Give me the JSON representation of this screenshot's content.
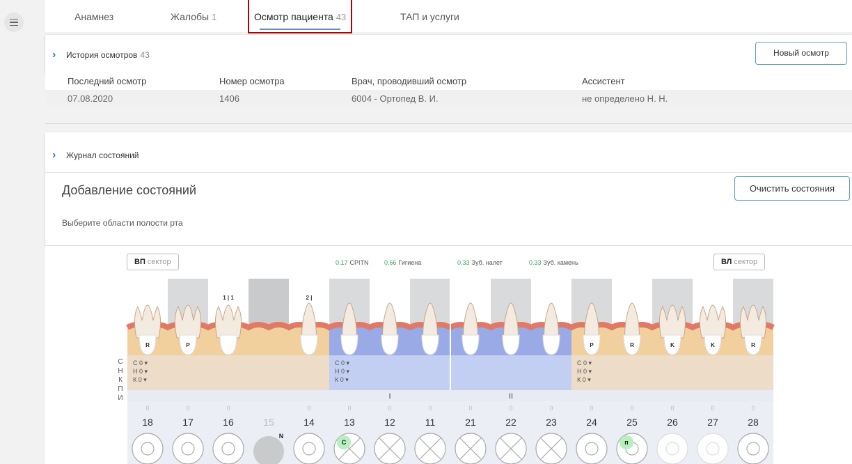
{
  "tabs": [
    {
      "label": "Анамнез",
      "count": ""
    },
    {
      "label": "Жалобы",
      "count": "1"
    },
    {
      "label": "Осмотр пациента",
      "count": "43"
    },
    {
      "label": "ТАП и услуги",
      "count": ""
    }
  ],
  "history": {
    "title": "История осмотров",
    "count": "43",
    "new_button": "Новый осмотр",
    "columns": [
      "Последний осмотр",
      "Номер осмотра",
      "Врач, проводивший осмотр",
      "Ассистент"
    ],
    "rows": [
      [
        "07.08.2020",
        "1406",
        "6004 - Ортопед В. И.",
        "не определено Н. Н."
      ]
    ]
  },
  "journal": {
    "title": "Журнал состояний",
    "add_title": "Добавление состояний",
    "clear_button": "Очистить состояния",
    "hint": "Выберите области полости рта"
  },
  "chart": {
    "left_sector": {
      "bold": "ВП",
      "text": "сектор"
    },
    "right_sector": {
      "bold": "ВЛ",
      "text": "сектор"
    },
    "metrics": [
      {
        "value": "0.17",
        "label": "CPITN"
      },
      {
        "value": "0.66",
        "label": "Гигиена"
      },
      {
        "value": "0.33",
        "label": "Зуб. налет"
      },
      {
        "value": "0.33",
        "label": "Зуб. камень"
      }
    ],
    "row_letters": [
      "С",
      "Н",
      "К",
      "П",
      "И"
    ],
    "group_rows": [
      "С 0",
      "Н 0",
      "К 0"
    ],
    "quadrants": [
      "I",
      "II"
    ],
    "upper_marks": {
      "16": "1 | 1",
      "14": "2 |"
    },
    "teeth": [
      {
        "num": "18",
        "root_label": "R",
        "zero": "0",
        "crown": "normal",
        "mark": ""
      },
      {
        "num": "17",
        "root_label": "P",
        "zero": "0",
        "crown": "normal",
        "mark": ""
      },
      {
        "num": "16",
        "root_label": "",
        "zero": "0",
        "crown": "normal",
        "mark": ""
      },
      {
        "num": "15",
        "root_label": "",
        "zero": "",
        "crown": "missing",
        "mark": "N"
      },
      {
        "num": "14",
        "root_label": "",
        "zero": "0",
        "crown": "normal",
        "mark": ""
      },
      {
        "num": "13",
        "root_label": "",
        "zero": "0",
        "crown": "cross",
        "mark": "C"
      },
      {
        "num": "12",
        "root_label": "",
        "zero": "0",
        "crown": "cross",
        "mark": ""
      },
      {
        "num": "11",
        "root_label": "",
        "zero": "0",
        "crown": "cross",
        "mark": ""
      },
      {
        "num": "21",
        "root_label": "",
        "zero": "0",
        "crown": "cross",
        "mark": ""
      },
      {
        "num": "22",
        "root_label": "",
        "zero": "0",
        "crown": "cross",
        "mark": ""
      },
      {
        "num": "23",
        "root_label": "",
        "zero": "0",
        "crown": "cross",
        "mark": ""
      },
      {
        "num": "24",
        "root_label": "P",
        "zero": "0",
        "crown": "normal",
        "mark": ""
      },
      {
        "num": "25",
        "root_label": "R",
        "zero": "0",
        "crown": "normal",
        "mark": "п"
      },
      {
        "num": "26",
        "root_label": "K",
        "zero": "0",
        "crown": "faded",
        "mark": ""
      },
      {
        "num": "27",
        "root_label": "K",
        "zero": "0",
        "crown": "faded",
        "mark": ""
      },
      {
        "num": "28",
        "root_label": "R",
        "zero": "0",
        "crown": "normal",
        "mark": ""
      }
    ],
    "colors": {
      "gum": "#e07a66",
      "bone_orange": "#f1d09e",
      "bone_blue": "#9aaae6",
      "status_orange": "#ecdcc8",
      "status_blue": "#c3cff2",
      "metric": "#33a65a",
      "mark_green": "#b8eec0"
    }
  }
}
